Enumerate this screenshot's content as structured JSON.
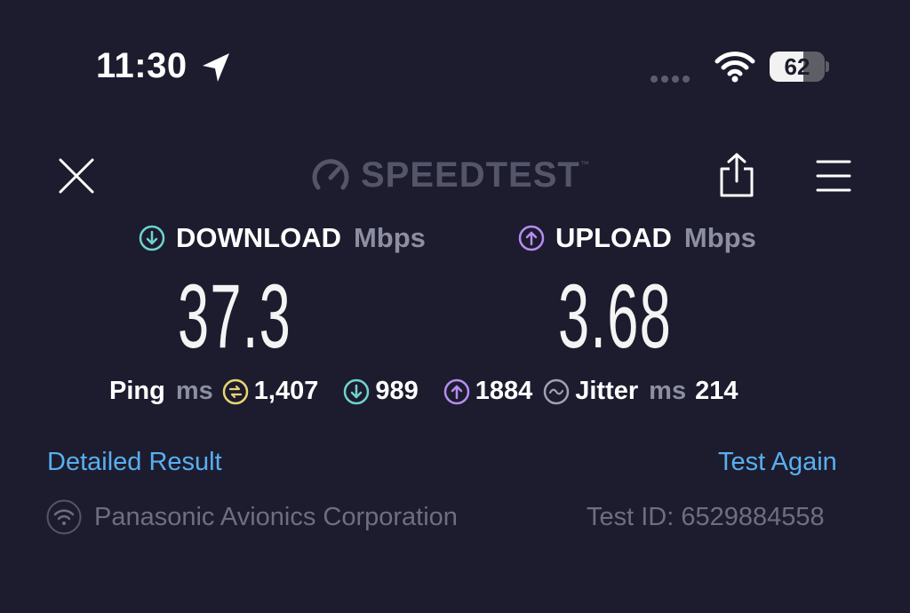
{
  "status_bar": {
    "time": "11:30",
    "battery": "62",
    "battery_level": 0.62,
    "icons": [
      "location-arrow-icon",
      "signal-dots-icon",
      "wifi-icon",
      "battery-icon"
    ]
  },
  "header": {
    "logo_text": "SPEEDTEST",
    "logo_tm": "™",
    "icons": [
      "close-icon",
      "speedometer-icon",
      "share-icon",
      "menu-icon"
    ]
  },
  "download": {
    "label": "DOWNLOAD",
    "unit": "Mbps",
    "value": "37.3",
    "icon": "download-arrow-icon",
    "color": "#6fd3cf"
  },
  "upload": {
    "label": "UPLOAD",
    "unit": "Mbps",
    "value": "3.68",
    "icon": "upload-arrow-icon",
    "color": "#b78cf0"
  },
  "stats": {
    "ping_label": "Ping",
    "ping_unit": "ms",
    "idle_ping": "1,407",
    "download_ping": "989",
    "upload_ping": "1884",
    "jitter_label": "Jitter",
    "jitter_unit": "ms",
    "jitter": "214",
    "idle_color": "#e9d574"
  },
  "links": {
    "detailed": "Detailed Result",
    "test_again": "Test Again",
    "color": "#5aaef0"
  },
  "footer": {
    "provider": "Panasonic Avionics Corporation",
    "test_id": "Test ID: 6529884558"
  }
}
